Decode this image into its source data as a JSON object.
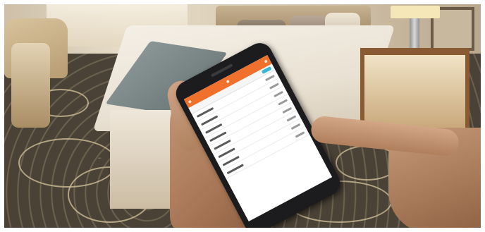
{
  "scene": {
    "palette": {
      "carpet": "#4a4236",
      "carpet_swirl": "#d6c49e",
      "bedding": "#f4efe6",
      "bed_runner": "#7a8686",
      "nightstand_wood": "#8a5a32",
      "phone_body": "#1c1c1e",
      "app_header": "#f0712c",
      "app_accent": "#3bb6d4"
    },
    "phone_app": {
      "row_count": 8
    }
  }
}
